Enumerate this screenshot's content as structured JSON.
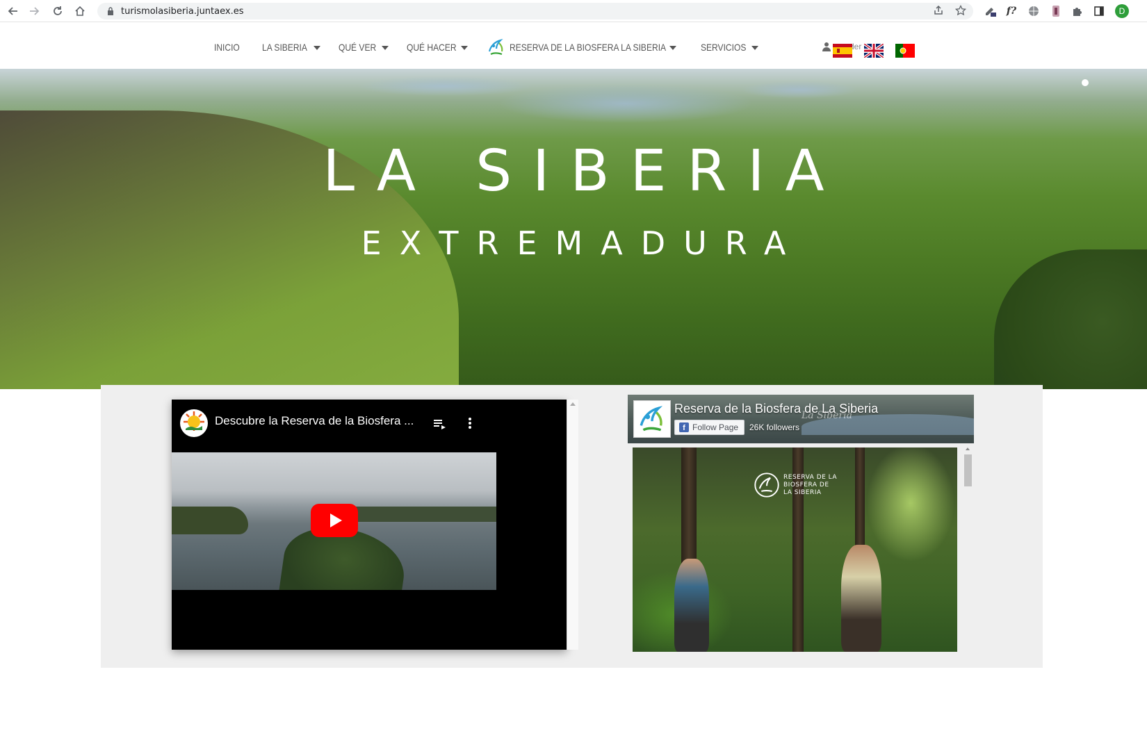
{
  "browser": {
    "url": "turismolasiberia.juntaex.es",
    "profile_initial": "D",
    "icons": [
      "back-arrow-icon",
      "forward-arrow-icon",
      "reload-icon",
      "home-icon",
      "lock-icon",
      "share-icon",
      "star-icon",
      "extension-icon",
      "font-extension-icon",
      "globe-extension-icon",
      "puzzle-icon",
      "sidepanel-icon",
      "profile-avatar"
    ],
    "font_ext_label": "f?"
  },
  "nav": {
    "items": [
      {
        "label": "INICIO",
        "has_caret": false
      },
      {
        "label": "LA SIBERIA",
        "has_caret": true
      },
      {
        "label": "QUÉ VER",
        "has_caret": true
      },
      {
        "label": "QUÉ HACER",
        "has_caret": true
      },
      {
        "label": "RESERVA DE LA BIOSFERA LA SIBERIA",
        "has_caret": true
      },
      {
        "label": "SERVICIOS",
        "has_caret": true
      }
    ],
    "lang_partial": "der",
    "languages": [
      "es",
      "en",
      "pt"
    ]
  },
  "hero": {
    "title": "LA SIBERIA",
    "subtitle": "EXTREMADURA"
  },
  "youtube": {
    "title": "Descubre la Reserva de la Biosfera ...",
    "accent": "#ff0000"
  },
  "facebook": {
    "page_name": "Reserva de la Biosfera de La Siberia",
    "follow_label": "Follow Page",
    "followers": "26K followers",
    "post_brand": [
      "RESERVA DE LA",
      "BIOSFERA DE",
      "LA SIBERIA"
    ],
    "accent": "#4267b2"
  }
}
